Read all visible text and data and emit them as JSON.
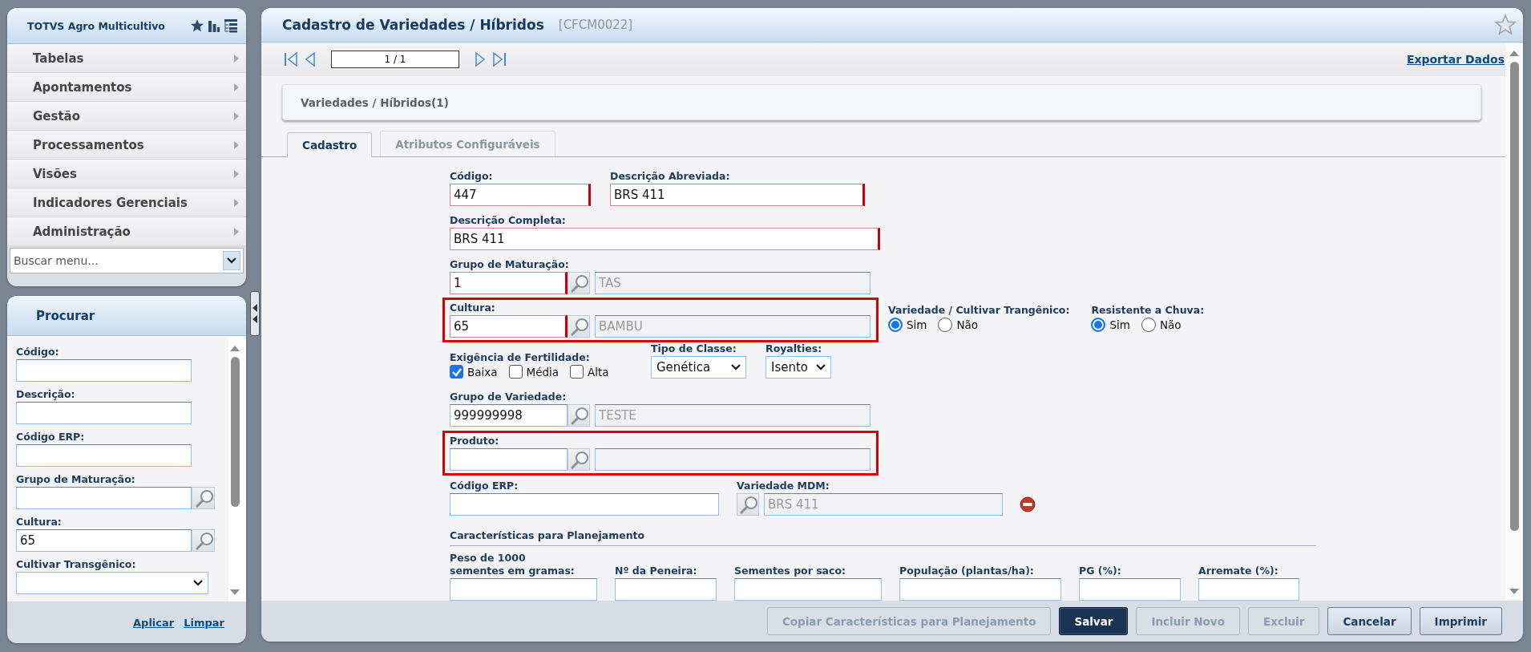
{
  "menu": {
    "title": "TOTVS Agro Multicultivo",
    "items": [
      {
        "label": "Tabelas"
      },
      {
        "label": "Apontamentos"
      },
      {
        "label": "Gestão"
      },
      {
        "label": "Processamentos"
      },
      {
        "label": "Visões"
      },
      {
        "label": "Indicadores Gerenciais"
      },
      {
        "label": "Administração"
      }
    ],
    "search": {
      "placeholder": "Buscar menu..."
    }
  },
  "filter_panel": {
    "title": "Procurar",
    "fields": [
      {
        "kind": "text",
        "label": "Código:"
      },
      {
        "kind": "text",
        "label": "Descrição:"
      },
      {
        "kind": "text",
        "label": "Código ERP:"
      },
      {
        "kind": "lookup",
        "label": "Grupo de Maturação:"
      },
      {
        "kind": "lookup",
        "label": "Cultura:",
        "value": "65"
      },
      {
        "kind": "select",
        "label": "Cultivar Transgênico:"
      }
    ],
    "links": [
      "Aplicar",
      "Limpar"
    ]
  },
  "window": {
    "title": "Cadastro de Variedades / Híbridos",
    "code": "[CFCM0022]"
  },
  "pager": {
    "value": "1 / 1"
  },
  "export_link": "Exportar Dados",
  "breadcrumb": "Variedades / Híbridos(1)",
  "tabs": [
    {
      "label": "Cadastro",
      "selected": true
    },
    {
      "label": "Atributos Configuráveis",
      "selected": false
    }
  ],
  "form": {
    "rows": [
      {
        "fields": [
          {
            "kind": "text",
            "label": "Código:",
            "value": "447",
            "required": true
          },
          {
            "kind": "text",
            "label": "Descrição Abreviada:",
            "value": "BRS 411",
            "required": true
          }
        ]
      },
      {
        "fields": [
          {
            "kind": "text",
            "label": "Descrição Completa:",
            "value": "BRS 411",
            "required": true
          }
        ]
      },
      {
        "fields": [
          {
            "kind": "lookup",
            "label": "Grupo de Maturação:",
            "value": "1",
            "description": "TAS",
            "required": true,
            "highlighted": false
          }
        ]
      },
      {
        "fields": [
          {
            "kind": "lookup",
            "label": "Cultura:",
            "value": "65",
            "description": "BAMBU",
            "required": true,
            "highlighted": true
          },
          {
            "kind": "radio",
            "label": "Variedade / Cultivar Trangênico:",
            "options": [
              {
                "label": "Sim",
                "selected": true
              },
              {
                "label": "Não",
                "selected": false
              }
            ]
          },
          {
            "kind": "radio",
            "label": "Resistente a Chuva:",
            "options": [
              {
                "label": "Sim",
                "selected": true
              },
              {
                "label": "Não",
                "selected": false
              }
            ]
          }
        ]
      },
      {
        "fields": [
          {
            "kind": "checks",
            "label": "Exigência de Fertilidade:",
            "options": [
              {
                "label": "Baixa",
                "checked": true
              },
              {
                "label": "Média",
                "checked": false
              },
              {
                "label": "Alta",
                "checked": false
              }
            ]
          },
          {
            "kind": "select",
            "label": "Tipo de Classe:",
            "value": "Genética"
          },
          {
            "kind": "select",
            "label": "Royalties:",
            "value": "Isento"
          }
        ]
      },
      {
        "fields": [
          {
            "kind": "lookup",
            "label": "Grupo de Variedade:",
            "value": "999999998",
            "description": "TESTE",
            "required": false,
            "highlighted": false
          }
        ]
      },
      {
        "fields": [
          {
            "kind": "lookup",
            "label": "Produto:",
            "required": false,
            "highlighted": true
          }
        ]
      },
      {
        "fields": [
          {
            "kind": "text",
            "label": "Código ERP:",
            "required": false
          },
          {
            "kind": "mdm",
            "label": "Variedade MDM:",
            "description": "BRS 411"
          }
        ]
      },
      {
        "fields": [
          {
            "kind": "heading",
            "label": "Características para Planejamento"
          }
        ]
      },
      {
        "fields": [
          {
            "kind": "text",
            "label": "Peso de 1000\nsementes em gramas:",
            "required": false
          },
          {
            "kind": "text",
            "label": "Nº da Peneira:",
            "required": false
          },
          {
            "kind": "text",
            "label": "Sementes por saco:",
            "required": false
          },
          {
            "kind": "text",
            "label": "População (plantas/ha):",
            "required": false
          },
          {
            "kind": "text",
            "label": "PG (%):",
            "required": false
          },
          {
            "kind": "text",
            "label": "Arremate (%):",
            "required": false
          }
        ]
      }
    ]
  },
  "buttons": [
    {
      "label": "Copiar Características para Planejamento",
      "kind": "normal",
      "disabled": true
    },
    {
      "label": "Salvar",
      "kind": "primary",
      "disabled": false
    },
    {
      "label": "Incluir Novo",
      "kind": "normal",
      "disabled": true
    },
    {
      "label": "Excluir",
      "kind": "normal",
      "disabled": true
    },
    {
      "label": "Cancelar",
      "kind": "normal",
      "disabled": false
    },
    {
      "label": "Imprimir",
      "kind": "normal",
      "disabled": false
    }
  ]
}
